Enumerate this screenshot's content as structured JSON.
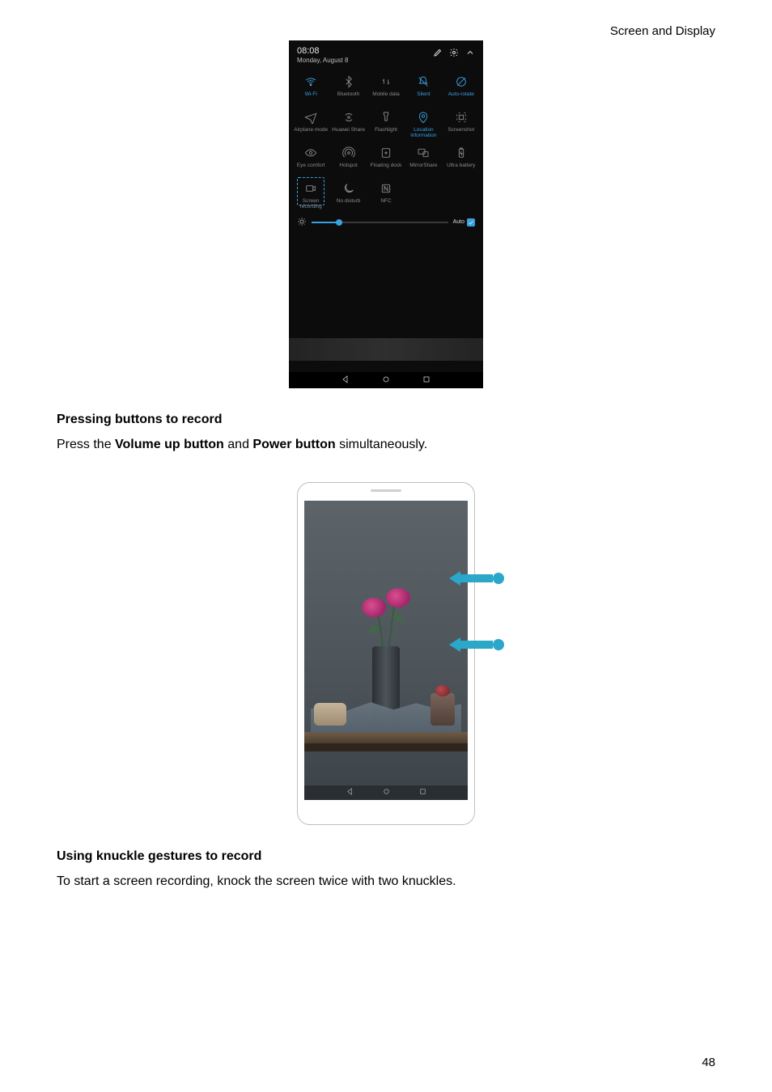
{
  "page": {
    "header_right": "Screen and Display",
    "number": "48"
  },
  "phone1": {
    "time": "08:08",
    "date": "Monday, August 8",
    "head_icons": {
      "edit": "edit-icon",
      "settings": "gear-icon",
      "collapse": "chevron-up-icon"
    },
    "tiles": [
      {
        "key": "wifi",
        "label": "Wi-Fi",
        "active": true
      },
      {
        "key": "bluetooth",
        "label": "Bluetooth",
        "active": false
      },
      {
        "key": "mobile-data",
        "label": "Mobile data",
        "active": false
      },
      {
        "key": "silent",
        "label": "Silent",
        "active": true
      },
      {
        "key": "auto-rotate",
        "label": "Auto-rotate",
        "active": true
      },
      {
        "key": "airplane",
        "label": "Airplane mode",
        "active": false
      },
      {
        "key": "huawei-share",
        "label": "Huawei Share",
        "active": false
      },
      {
        "key": "flashlight",
        "label": "Flashlight",
        "active": false
      },
      {
        "key": "location",
        "label": "Location information",
        "active": true
      },
      {
        "key": "screenshot",
        "label": "Screenshot",
        "active": false
      },
      {
        "key": "eye-comfort",
        "label": "Eye comfort",
        "active": false
      },
      {
        "key": "hotspot",
        "label": "Hotspot",
        "active": false
      },
      {
        "key": "floating-dock",
        "label": "Floating dock",
        "active": false
      },
      {
        "key": "mirrorshare",
        "label": "MirrorShare",
        "active": false
      },
      {
        "key": "ultra-battery",
        "label": "Ultra battery",
        "active": false
      },
      {
        "key": "screen-rec",
        "label": "Screen recording",
        "active": false,
        "highlight": true
      },
      {
        "key": "no-disturb",
        "label": "No disturb",
        "active": false
      },
      {
        "key": "nfc",
        "label": "NFC",
        "active": false
      }
    ],
    "brightness": {
      "auto_label": "Auto",
      "auto_checked": true,
      "level_percent": 20
    }
  },
  "section1": {
    "heading": "Pressing buttons to record",
    "line_pre": "Press the ",
    "bold1": "Volume up button",
    "mid": " and ",
    "bold2": "Power button",
    "line_post": " simultaneously."
  },
  "section2": {
    "heading": "Using knuckle gestures to record",
    "body": "To start a screen recording, knock the screen twice with two knuckles."
  }
}
